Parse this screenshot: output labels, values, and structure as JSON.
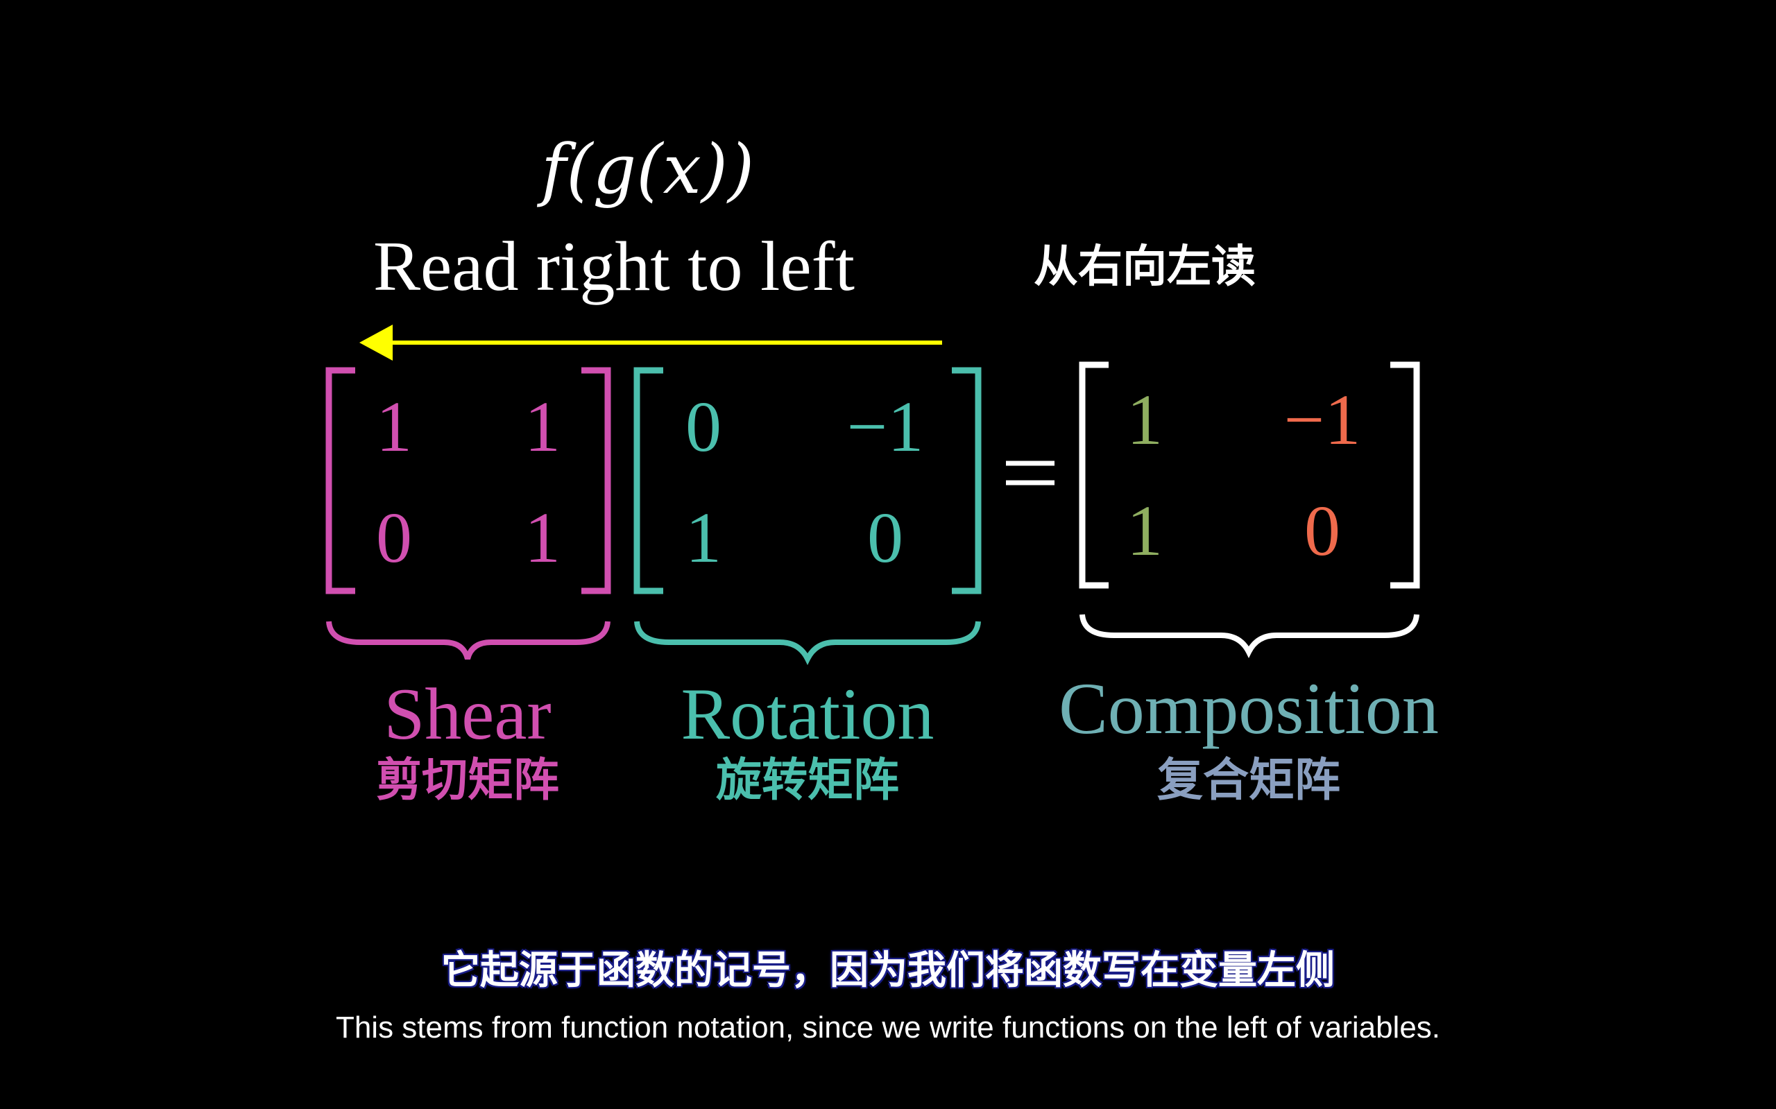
{
  "formula": "f(g(x))",
  "read_en": "Read right to left",
  "read_cn": "从右向左读",
  "colors": {
    "shear": "#d14fb0",
    "rotation": "#4bbfad",
    "composition_col1": "#8fae60",
    "composition_col2": "#ef6a4c",
    "arrow": "#ffff00",
    "white": "#ffffff"
  },
  "shear": {
    "matrix": [
      [
        "1",
        "1"
      ],
      [
        "0",
        "1"
      ]
    ],
    "label_en": "Shear",
    "label_cn": "剪切矩阵"
  },
  "rotation": {
    "matrix": [
      [
        "0",
        "−1"
      ],
      [
        "1",
        "0"
      ]
    ],
    "label_en": "Rotation",
    "label_cn": "旋转矩阵"
  },
  "equals": "=",
  "composition": {
    "matrix": [
      [
        "1",
        "−1"
      ],
      [
        "1",
        "0"
      ]
    ],
    "label_en": "Composition",
    "label_cn": "复合矩阵"
  },
  "subtitle_cn": "它起源于函数的记号，因为我们将函数写在变量左侧",
  "subtitle_en": "This stems from function notation, since we write functions on the left of variables."
}
